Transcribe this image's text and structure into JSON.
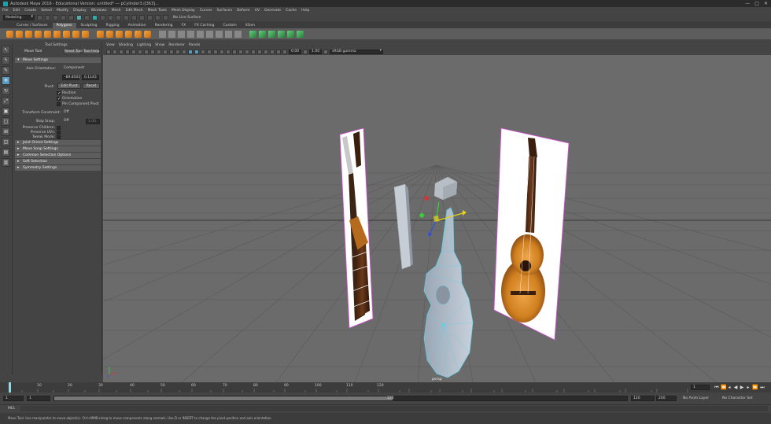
{
  "window": {
    "title": "Autodesk Maya 2016 - Educational Version: untitled*   ---   pCylinder3.i[363]...",
    "controls": [
      "—",
      "□",
      "✕"
    ]
  },
  "menubar": [
    "File",
    "Edit",
    "Create",
    "Select",
    "Modify",
    "Display",
    "Windows",
    "Mesh",
    "Edit Mesh",
    "Mesh Tools",
    "Mesh Display",
    "Curves",
    "Surfaces",
    "Deform",
    "UV",
    "Generate",
    "Cache",
    "Help"
  ],
  "status_line": {
    "mode": "Modeling",
    "live_surface": "No Live Surface"
  },
  "shelf_tabs": [
    "Curves / Surfaces",
    "Polygons",
    "Sculpting",
    "Rigging",
    "Animation",
    "Rendering",
    "FX",
    "FX Caching",
    "Custom",
    "XGen"
  ],
  "active_shelf": "Polygons",
  "tool_settings": {
    "header": "Tool Settings",
    "tool_name": "Move Tool",
    "reset_tool": "Reset Tool",
    "tool_help": "Tool Help",
    "move_settings": "Move Settings",
    "axis_orientation_label": "Axis Orientation:",
    "axis_orientation_value": "Component",
    "coord_1": "-89.8501",
    "coord_2": "0.1143",
    "pivot_label": "Pivot:",
    "edit_pivot": "Edit Pivot",
    "reset": "Reset",
    "position": "Position",
    "orientation": "Orientation",
    "pin_component_pivot": "Pin Component Pivot",
    "transform_constraint_label": "Transform Constraint:",
    "transform_constraint_value": "Off",
    "step_snap_label": "Step Snap:",
    "step_snap_value": "Off",
    "step_snap_num": "1.00",
    "preserve_children": "Preserve Children:",
    "preserve_uvs": "Preserve UVs:",
    "tweak_mode": "Tweak Mode:",
    "sections": [
      "Joint Orient Settings",
      "Move Snap Settings",
      "Common Selection Options",
      "Soft Selection",
      "Symmetry Settings"
    ]
  },
  "viewport": {
    "menus": [
      "View",
      "Shading",
      "Lighting",
      "Show",
      "Renderer",
      "Panels"
    ],
    "exposure": "0.00",
    "gamma": "1.00",
    "color_space": "sRGB gamma",
    "camera": "persp"
  },
  "time": {
    "ticks": [
      "1",
      "5",
      "10",
      "15",
      "20",
      "25",
      "30",
      "35",
      "40",
      "45",
      "50",
      "55",
      "60",
      "65",
      "70",
      "75",
      "80",
      "85",
      "90",
      "95",
      "100",
      "105",
      "110",
      "115",
      "120"
    ],
    "current_frame": "1",
    "range_start": "1",
    "range_start_2": "1",
    "range_inner_end": "120",
    "range_end": "120",
    "anim_end": "200",
    "anim_layer": "No Anim Layer",
    "char_set": "No Character Set"
  },
  "command_line": {
    "label": "MEL"
  },
  "help_line": "Move Tool: Use manipulator to move object(s). Ctrl+MMB+drag to move components along normals. Use D or INSERT to change the pivot position and axis orientation."
}
